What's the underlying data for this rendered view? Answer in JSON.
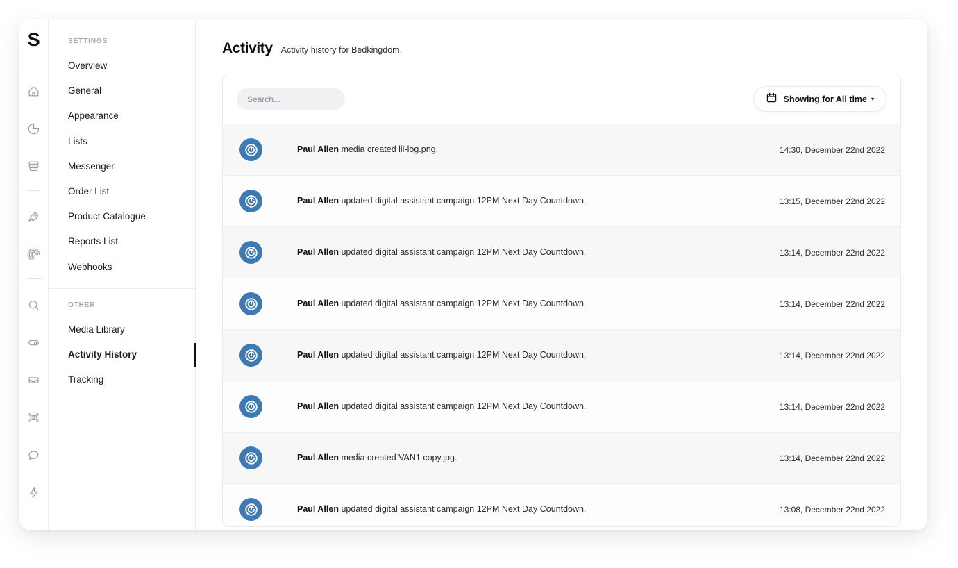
{
  "brand": {
    "logo_letter": "S",
    "accent": "#3f79b4"
  },
  "rail": {
    "icons": [
      "home-icon",
      "pie-chart-icon",
      "archive-icon",
      "rocket-icon",
      "target-icon",
      "search-icon",
      "toggle-icon",
      "inbox-icon",
      "camera-icon",
      "chat-bubble-icon",
      "lightning-icon"
    ]
  },
  "sidebar": {
    "settings_title": "SETTINGS",
    "settings_items": [
      {
        "label": "Overview",
        "active": false
      },
      {
        "label": "General",
        "active": false
      },
      {
        "label": "Appearance",
        "active": false
      },
      {
        "label": "Lists",
        "active": false
      },
      {
        "label": "Messenger",
        "active": false
      },
      {
        "label": "Order List",
        "active": false
      },
      {
        "label": "Product Catalogue",
        "active": false
      },
      {
        "label": "Reports List",
        "active": false
      },
      {
        "label": "Webhooks",
        "active": false
      }
    ],
    "other_title": "OTHER",
    "other_items": [
      {
        "label": "Media Library",
        "active": false
      },
      {
        "label": "Activity History",
        "active": true
      },
      {
        "label": "Tracking",
        "active": false
      }
    ]
  },
  "header": {
    "title": "Activity",
    "subtitle": "Activity history for Bedkingdom."
  },
  "toolbar": {
    "search_placeholder": "Search...",
    "search_value": "",
    "date_filter_label": "Showing for All time",
    "date_filter_caret": "▾",
    "calendar_icon": "calendar-icon"
  },
  "activity": {
    "rows": [
      {
        "actor": "Paul Allen",
        "text": " media created lil-log.png.",
        "time": "14:30, December 22nd 2022"
      },
      {
        "actor": "Paul Allen",
        "text": " updated digital assistant campaign 12PM Next Day Countdown.",
        "time": "13:15, December 22nd 2022"
      },
      {
        "actor": "Paul Allen",
        "text": " updated digital assistant campaign 12PM Next Day Countdown.",
        "time": "13:14, December 22nd 2022"
      },
      {
        "actor": "Paul Allen",
        "text": " updated digital assistant campaign 12PM Next Day Countdown.",
        "time": "13:14, December 22nd 2022"
      },
      {
        "actor": "Paul Allen",
        "text": " updated digital assistant campaign 12PM Next Day Countdown.",
        "time": "13:14, December 22nd 2022"
      },
      {
        "actor": "Paul Allen",
        "text": " updated digital assistant campaign 12PM Next Day Countdown.",
        "time": "13:14, December 22nd 2022"
      },
      {
        "actor": "Paul Allen",
        "text": " media created VAN1 copy.jpg.",
        "time": "13:14, December 22nd 2022"
      },
      {
        "actor": "Paul Allen",
        "text": " updated digital assistant campaign 12PM Next Day Countdown.",
        "time": "13:08, December 22nd 2022"
      }
    ]
  }
}
